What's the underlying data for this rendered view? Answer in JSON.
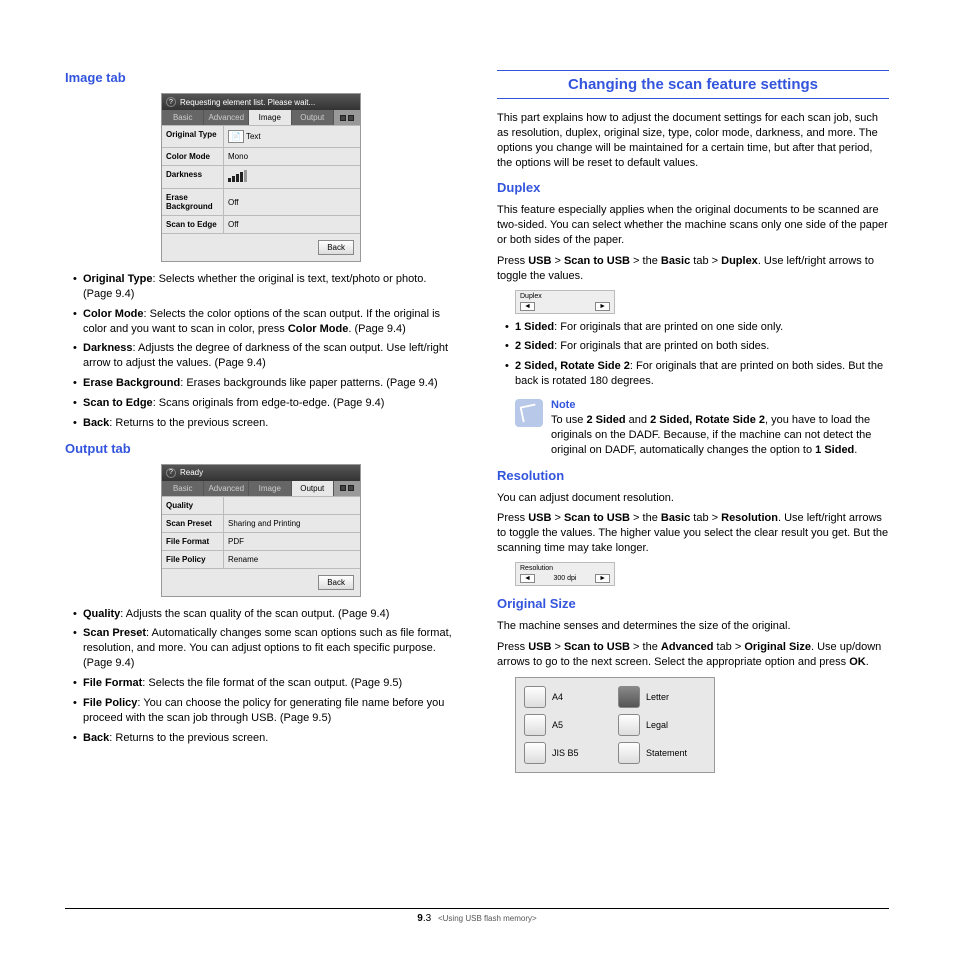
{
  "left": {
    "image_tab": {
      "heading": "Image tab",
      "mock": {
        "title": "Requesting element list. Please wait...",
        "tabs": [
          "Basic",
          "Advanced",
          "Image",
          "Output"
        ],
        "active": 2,
        "rows": [
          {
            "label": "Original Type",
            "value": "Text"
          },
          {
            "label": "Color Mode",
            "value": "Mono"
          },
          {
            "label": "Darkness",
            "value": ""
          },
          {
            "label": "Erase Background",
            "value": "Off"
          },
          {
            "label": "Scan to Edge",
            "value": "Off"
          }
        ],
        "back": "Back"
      },
      "bullets": [
        {
          "b": "Original Type",
          "t": ": Selects whether the original is text, text/photo or photo. (Page 9.4)"
        },
        {
          "b": "Color Mode",
          "t": ": Selects the color options of the scan output. If the original is color and you want to scan in color, press ",
          "b2": "Color Mode",
          "t2": ". (Page 9.4)"
        },
        {
          "b": "Darkness",
          "t": ": Adjusts the degree of darkness of the scan output. Use left/right arrow to adjust the values. (Page 9.4)"
        },
        {
          "b": "Erase Background",
          "t": ": Erases backgrounds like paper patterns. (Page 9.4)"
        },
        {
          "b": "Scan to Edge",
          "t": ": Scans originals from edge-to-edge. (Page 9.4)"
        },
        {
          "b": "Back",
          "t": ": Returns to the previous screen."
        }
      ]
    },
    "output_tab": {
      "heading": "Output tab",
      "mock": {
        "title": "Ready",
        "tabs": [
          "Basic",
          "Advanced",
          "Image",
          "Output"
        ],
        "active": 3,
        "rows": [
          {
            "label": "Quality",
            "value": ""
          },
          {
            "label": "Scan Preset",
            "value": "Sharing and Printing"
          },
          {
            "label": "File Format",
            "value": "PDF"
          },
          {
            "label": "File Policy",
            "value": "Rename"
          }
        ],
        "back": "Back"
      },
      "bullets": [
        {
          "b": "Quality",
          "t": ": Adjusts the scan quality of the scan output. (Page 9.4)"
        },
        {
          "b": "Scan Preset",
          "t": ": Automatically changes some scan options such as file format, resolution, and more. You can adjust options to fit each specific purpose. (Page 9.4)"
        },
        {
          "b": "File Format",
          "t": ": Selects the file format of the scan output. (Page 9.5)"
        },
        {
          "b": "File Policy",
          "t": ": You can choose the policy for generating file name before you proceed with the scan job through USB. (Page 9.5)"
        },
        {
          "b": "Back",
          "t": ": Returns to the previous screen."
        }
      ]
    }
  },
  "right": {
    "main_heading": "Changing the scan feature settings",
    "intro": "This part explains how to adjust the document settings for each scan job, such as resolution, duplex, original size, type, color mode, darkness, and more. The options you change will be maintained for a certain time, but after that period, the options will be reset to default values.",
    "duplex": {
      "heading": "Duplex",
      "p1": "This feature especially applies when the original documents to be scanned are two-sided. You can select whether the machine scans only one side of the paper or both sides of the paper.",
      "p2_parts": [
        "Press ",
        "USB",
        " > ",
        "Scan to USB",
        " > the ",
        "Basic",
        " tab > ",
        "Duplex",
        ". Use left/right arrows to toggle the values."
      ],
      "mini_label": "Duplex",
      "bullets": [
        {
          "b": "1 Sided",
          "t": ": For originals that are printed on one side only."
        },
        {
          "b": "2 Sided",
          "t": ": For originals that are printed on both sides."
        },
        {
          "b": "2 Sided, Rotate Side 2",
          "t": ": For originals that are printed on both sides. But the back is rotated 180 degrees."
        }
      ],
      "note": {
        "title": "Note",
        "parts": [
          "To use ",
          "2 Sided",
          " and ",
          "2 Sided, Rotate Side 2",
          ", you have to load the originals on the DADF. Because, if the machine can not detect the original on DADF, automatically changes the option to ",
          "1 Sided",
          "."
        ]
      }
    },
    "resolution": {
      "heading": "Resolution",
      "p1": "You can adjust document resolution.",
      "p2_parts": [
        "Press ",
        "USB",
        " > ",
        "Scan to USB",
        " > the ",
        "Basic",
        " tab > ",
        "Resolution",
        ". Use left/right arrows to toggle the values. The higher value you select the clear result you get. But the scanning time may take longer."
      ],
      "mini_label": "Resolution",
      "mini_value": "300 dpi"
    },
    "original_size": {
      "heading": "Original Size",
      "p1": "The machine senses and determines the size of the original.",
      "p2_parts": [
        "Press ",
        "USB",
        " > ",
        "Scan to USB",
        " > the ",
        "Advanced",
        " tab > ",
        "Original Size",
        ". Use up/down arrows to go to the next screen. Select the appropriate option and press ",
        "OK",
        "."
      ],
      "sizes": [
        {
          "label": "A4",
          "dark": false
        },
        {
          "label": "Letter",
          "dark": true
        },
        {
          "label": "A5",
          "dark": false
        },
        {
          "label": "Legal",
          "dark": false
        },
        {
          "label": "JIS B5",
          "dark": false
        },
        {
          "label": "Statement",
          "dark": false
        }
      ]
    }
  },
  "footer": {
    "page_num": "9",
    "page_sub": ".3",
    "title": "<Using USB flash memory>"
  }
}
